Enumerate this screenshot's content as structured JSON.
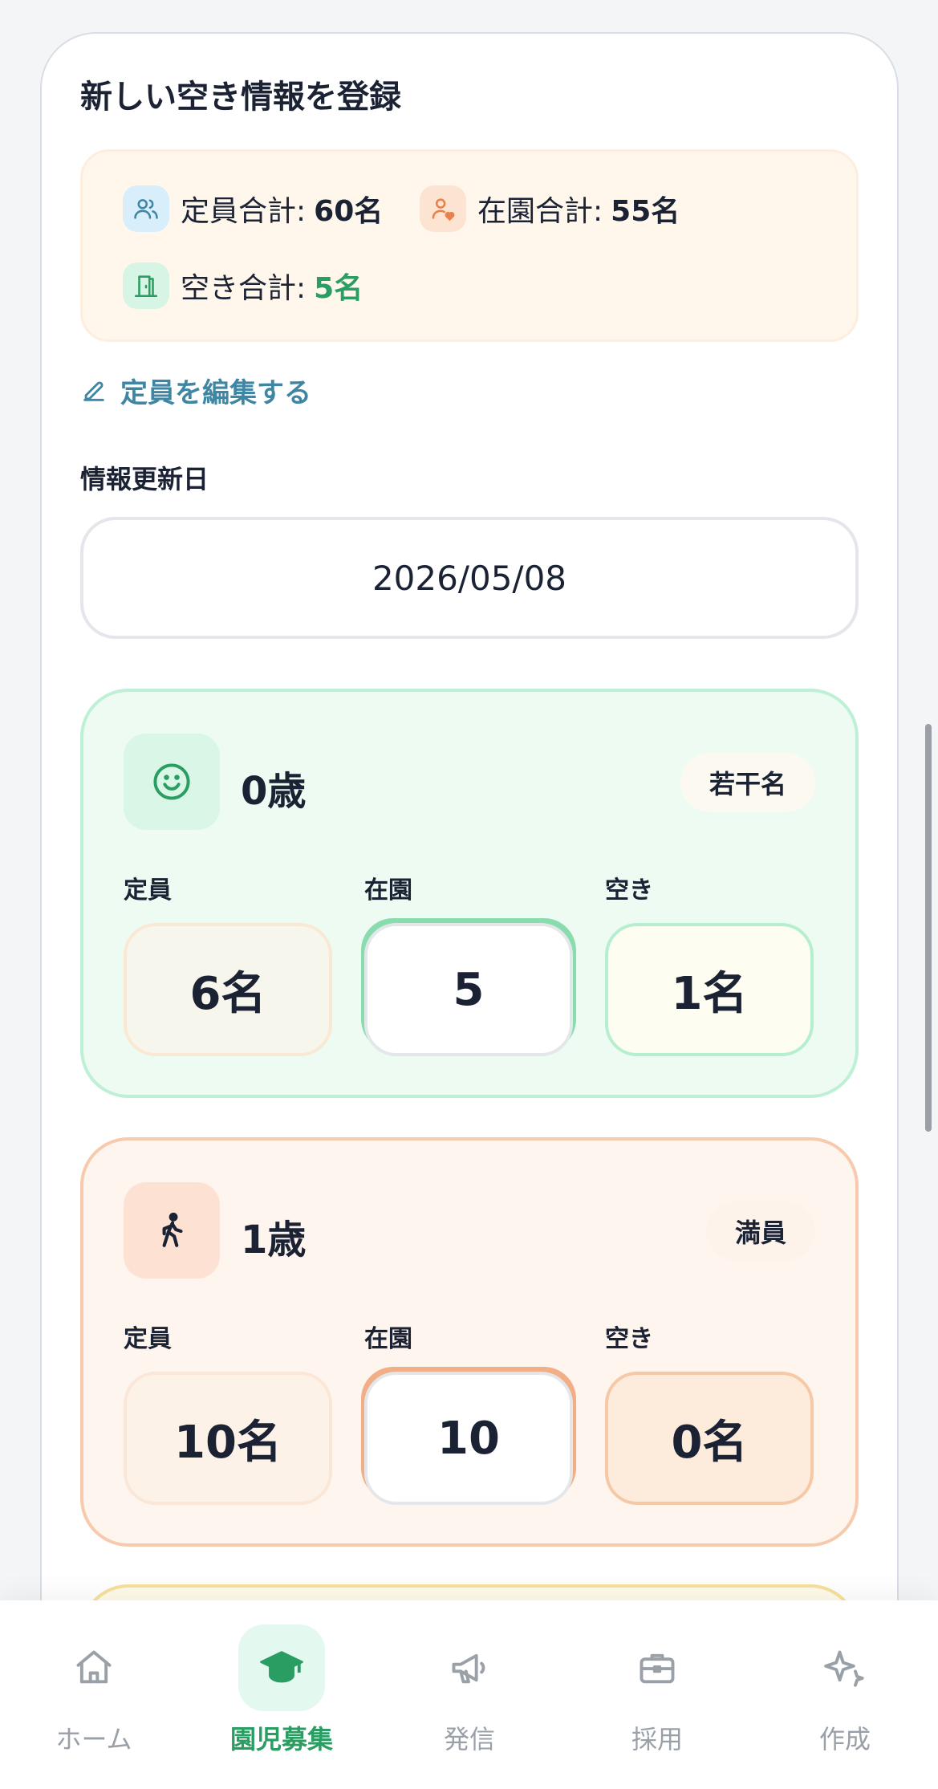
{
  "page": {
    "title": "新しい空き情報を登録"
  },
  "summary": {
    "capacity_label": "定員合計:",
    "capacity_value": "60名",
    "enrolled_label": "在園合計:",
    "enrolled_value": "55名",
    "vacancy_label": "空き合計:",
    "vacancy_value": "5名"
  },
  "edit_link": "定員を編集する",
  "update_date": {
    "label": "情報更新日",
    "value": "2026/05/08"
  },
  "age_groups": [
    {
      "name": "0歳",
      "badge": "若干名",
      "capacity_label": "定員",
      "enrolled_label": "在園",
      "vacancy_label": "空き",
      "capacity": "6名",
      "enrolled": "5",
      "vacancy": "1名",
      "icon": "smile-icon"
    },
    {
      "name": "1歳",
      "badge": "満員",
      "capacity_label": "定員",
      "enrolled_label": "在園",
      "vacancy_label": "空き",
      "capacity": "10名",
      "enrolled": "10",
      "vacancy": "0名",
      "icon": "walking-person-icon"
    }
  ],
  "bottom_nav": {
    "items": [
      {
        "label": "ホーム",
        "icon": "home-icon"
      },
      {
        "label": "園児募集",
        "icon": "graduation-cap-icon"
      },
      {
        "label": "発信",
        "icon": "megaphone-icon"
      },
      {
        "label": "採用",
        "icon": "briefcase-icon"
      },
      {
        "label": "作成",
        "icon": "sparkle-icon"
      }
    ],
    "active_index": 1
  },
  "colors": {
    "accent_green": "#2a9d62",
    "link_blue": "#3f86a4",
    "nav_inactive": "#9aa0a8"
  }
}
